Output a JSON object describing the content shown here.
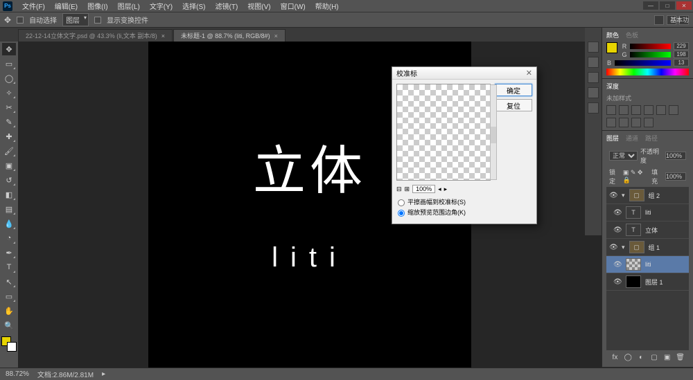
{
  "menu": {
    "items": [
      "文件(F)",
      "编辑(E)",
      "图像(I)",
      "图层(L)",
      "文字(Y)",
      "选择(S)",
      "滤镜(T)",
      "视图(V)",
      "窗口(W)",
      "帮助(H)"
    ]
  },
  "optbar": {
    "auto": "自动选择",
    "mode": "图层",
    "bounds": "显示变换控件"
  },
  "tabs": [
    {
      "label": "22-12-14立体文字.psd @ 43.3% (li,文本 副本/8)"
    },
    {
      "label": "未标题-1 @ 88.7% (liti, RGB/8#)"
    }
  ],
  "right_top": "基本功",
  "canvas": {
    "big": "立体",
    "sub": "liti"
  },
  "status": {
    "zoom": "88.72%",
    "info": "文档:2.86M/2.81M"
  },
  "dialog": {
    "title": "校准标",
    "ok": "确定",
    "reset": "复位",
    "zoom": "100%",
    "radio1": "平擦画幅到校准标(S)",
    "radio2": "缩放预览范围边角(K)"
  },
  "panels": {
    "color_tab1": "颜色",
    "color_tab2": "色板",
    "r": "229",
    "g": "198",
    "b": "13",
    "style_tab1": "深度",
    "style_tab2": "",
    "style_title": "未加样式",
    "layers_tab1": "图层",
    "layers_tab2": "通道",
    "layers_tab3": "路径",
    "blend": "正常",
    "opacity_lab": "不透明度",
    "opacity": "100%",
    "lock_lab": "锁定",
    "fill_lab": "填充",
    "fill": "100%",
    "group1": "组 2",
    "layer_t1": "liti",
    "layer_t2": "立体",
    "group2": "组 1",
    "layer_sel": "liti",
    "layer_bg": "图层 1"
  }
}
